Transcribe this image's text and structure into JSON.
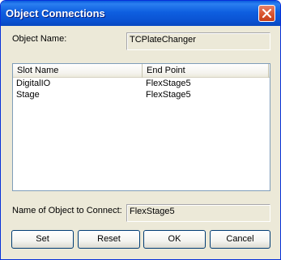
{
  "window": {
    "title": "Object Connections"
  },
  "object_name": {
    "label": "Object Name:",
    "value": "TCPlateChanger"
  },
  "list": {
    "columns": [
      "Slot Name",
      "End Point"
    ],
    "rows": [
      {
        "slot": "DigitalIO",
        "end_point": "FlexStage5"
      },
      {
        "slot": "Stage",
        "end_point": "FlexStage5"
      }
    ]
  },
  "connect": {
    "label": "Name of Object to Connect:",
    "value": "FlexStage5"
  },
  "buttons": {
    "set": "Set",
    "reset": "Reset",
    "ok": "OK",
    "cancel": "Cancel"
  },
  "icons": {
    "close": "close-icon"
  },
  "colors": {
    "title_bar": "#0a52d2",
    "close_button": "#d9552f",
    "dialog_bg": "#ece9d8"
  }
}
